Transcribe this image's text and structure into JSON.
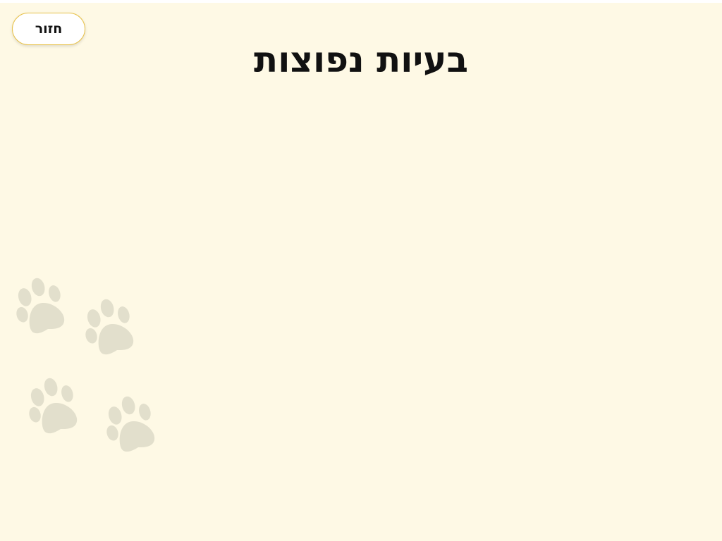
{
  "header": {
    "back_label": "חזור",
    "title": "בעיות נפוצות"
  },
  "decorations": {
    "paw_icon": "paw-print-icon",
    "paw_color": "#e2dfcc",
    "background_color": "#fef9e5",
    "button_border_color": "#e8c24a"
  }
}
